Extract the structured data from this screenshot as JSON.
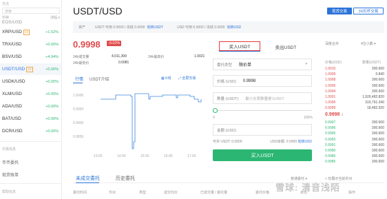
{
  "sidebar": {
    "top_label": "自选",
    "search_placeholder": "搜索",
    "headers": {
      "pair": "币种",
      "change": "涨幅 ▾"
    },
    "cut_top_pair": "EOS/USD",
    "pairs": [
      {
        "name": "XRP/USD",
        "badge": "3X",
        "change": "+1.52%"
      },
      {
        "name": "TRX/USD",
        "badge": "",
        "change": "+0.00%"
      },
      {
        "name": "BSV/USD",
        "badge": "",
        "change": "+4.94%"
      },
      {
        "name": "USDT/USD",
        "badge": "3X",
        "change": "+0.00%",
        "active": true
      },
      {
        "name": "USDK/USD",
        "badge": "",
        "change": "+0.00%"
      },
      {
        "name": "XLM/USD",
        "badge": "",
        "change": "+0.00%"
      },
      {
        "name": "ADA/USD",
        "badge": "",
        "change": "+0.00%"
      },
      {
        "name": "BAT/USD",
        "badge": "",
        "change": "+0.00%"
      },
      {
        "name": "DCR/USD",
        "badge": "",
        "change": "+0.00%"
      }
    ],
    "section_title": "交易信息",
    "section_items": [
      "币币委托",
      "现货账单"
    ],
    "help_title": "帮助信息"
  },
  "header": {
    "pair_title": "USDT/USD",
    "tab_spot": "现货交易",
    "tab_margin": "3X杠杆交易"
  },
  "assets": {
    "label": "资产",
    "usdt_text": "USDT 可用 0.0000 / 冻结 0.0000",
    "usdt_link": "划转USDT",
    "usd_text": "USD 可用 0.0000 / 冻结 0.0000",
    "usd_link": "划转USD"
  },
  "ticker": {
    "price": "0.9998",
    "change": "-0.02%",
    "vol_label": "24h成交量",
    "vol_value": "4,011,399",
    "high_label": "24h最高价",
    "high_value": "1.0021",
    "amount_label": "24h成交额",
    "amount_value": "...",
    "low_label": "24h最低价",
    "low_value": "0.0081"
  },
  "chart": {
    "tab_market": "行情",
    "tab_intro": "USDT介绍",
    "tool_kline": "K线",
    "tool_fullscreen": "全屏交易",
    "y_ticks": [
      "1.0000",
      "0.9950",
      "0.9900",
      "0.9850"
    ],
    "x_ticks": [
      "13:00",
      "14:00",
      "15:00",
      "16:00",
      "17:00"
    ]
  },
  "chart_data": {
    "type": "line",
    "x": [
      "13:00",
      "14:00",
      "15:00",
      "16:00",
      "17:00"
    ],
    "series": [
      {
        "values": [
          1.0002,
          1.0002,
          0.9991,
          0.9998,
          0.9999
        ]
      }
    ],
    "ylim": [
      0.982,
      1.002
    ],
    "grid": false
  },
  "order_form": {
    "tab_buy": "买入USDT",
    "tab_sell": "卖出USDT",
    "type_label": "委托类型",
    "type_value": "限价单",
    "price_label": "价格 (USD)",
    "price_value": "0.9998",
    "qty_label": "数量 (USDT)",
    "qty_placeholder": "最小交易数量是1USDT",
    "slider_min": "0",
    "slider_max": "100%",
    "amount_label": "金额 (USD)",
    "avail_label": "可买 USDT: 0.0000",
    "avail_right": "USD余额: 0.0000",
    "avail_link": "划转USD",
    "buy_button": "买入USDT"
  },
  "order_book": {
    "depth_label": "深度合并",
    "decimals_label": "4位小数 ▾",
    "col_price": "价格(USD)",
    "col_amount": "数量(USDT)",
    "asks": [
      {
        "price": "1.0010",
        "amount": "300.600"
      },
      {
        "price": "1.0009",
        "amount": "0.840"
      },
      {
        "price": "1.0008",
        "amount": "300.600"
      },
      {
        "price": "1.0005",
        "amount": "300.600"
      },
      {
        "price": "1.0004",
        "amount": "300.600"
      },
      {
        "price": "1.0001",
        "amount": "1,926,482.820"
      },
      {
        "price": "1.0000",
        "amount": "319,791.340"
      },
      {
        "price": "0.9999",
        "amount": "18,482.920"
      }
    ],
    "mid_price": "0.9998 ↓",
    "bids": [
      {
        "price": "0.9997",
        "amount": "300.600"
      },
      {
        "price": "0.9996",
        "amount": "300.600"
      },
      {
        "price": "0.9995",
        "amount": "300.600"
      },
      {
        "price": "0.9993",
        "amount": "300.600"
      },
      {
        "price": "0.9991",
        "amount": "300.600"
      },
      {
        "price": "0.9990",
        "amount": "300.600"
      },
      {
        "price": "0.9986",
        "amount": "300.600"
      },
      {
        "price": "0.9985",
        "amount": "300.600"
      }
    ]
  },
  "orders": {
    "tab_open": "未成交委托",
    "tab_history": "历史委托",
    "filter_label": "普通委托 ▾",
    "hide_label": "□ 仅展示当前币对",
    "col_headers": [
      "委托时间",
      "币对",
      "类型",
      "成交均价",
      "已成交量 / 委托量",
      "委托价格",
      "状态",
      "操作"
    ]
  },
  "watermark": "雪球: 清音浅陌"
}
